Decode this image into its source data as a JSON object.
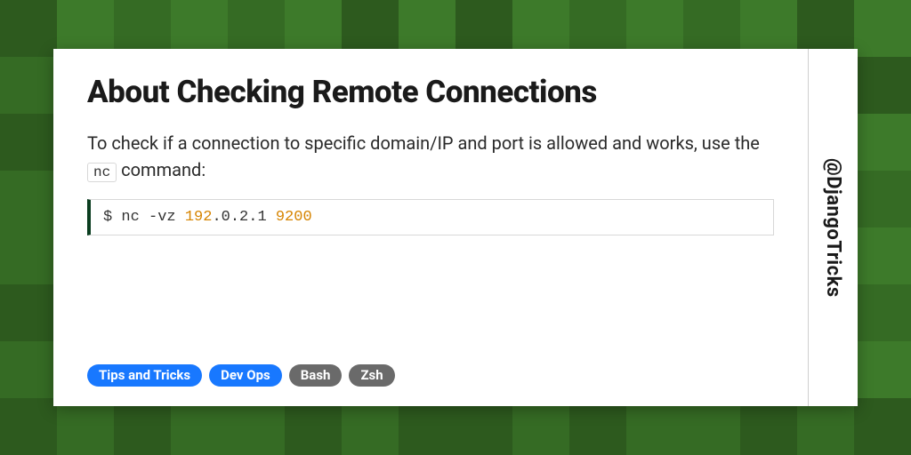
{
  "title": "About Checking Remote Connections",
  "description": {
    "pre": "To check if a connection to specific domain/IP and port is allowed and works, use the ",
    "code": "nc",
    "post": " command:"
  },
  "code": {
    "prompt": "$ ",
    "cmd": "nc -vz ",
    "ip_hl": "192",
    "ip_rest": ".0.2.1 ",
    "port": "9200"
  },
  "tags": [
    {
      "label": "Tips and Tricks",
      "color": "blue"
    },
    {
      "label": "Dev Ops",
      "color": "blue"
    },
    {
      "label": "Bash",
      "color": "gray"
    },
    {
      "label": "Zsh",
      "color": "gray"
    }
  ],
  "handle": "@DjangoTricks"
}
